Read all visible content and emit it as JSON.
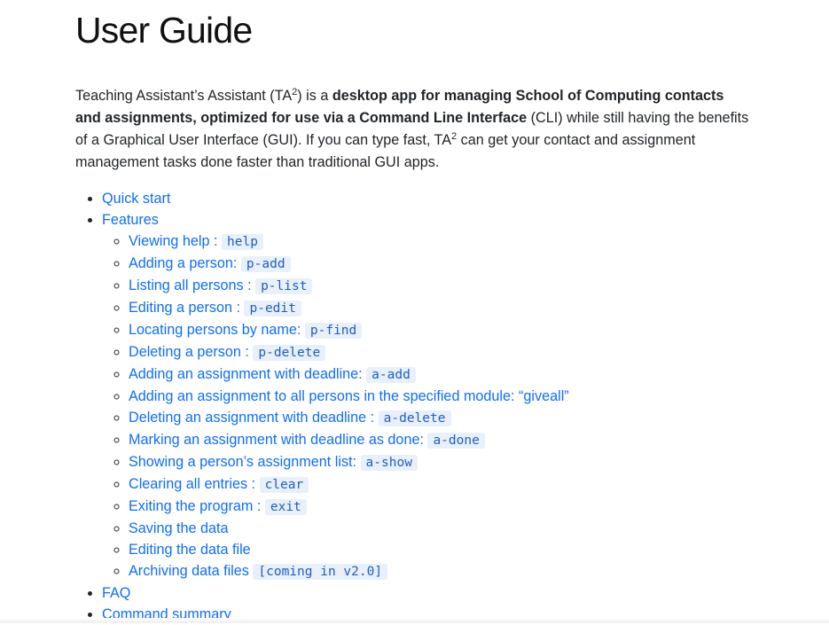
{
  "title": "User Guide",
  "intro": {
    "part1": "Teaching Assistant’s Assistant (TA",
    "sup1": "2",
    "part2": ") is a ",
    "bold": "desktop app for managing School of Computing contacts and assignments, optimized for use via a Command Line Interface",
    "part3": " (CLI) while still having the benefits of a Graphical User Interface (GUI). If you can type fast, TA",
    "sup2": "2",
    "part4": " can get your contact and assignment management tasks done faster than traditional GUI apps."
  },
  "toc": {
    "quick_start": "Quick start",
    "features": "Features",
    "faq": "FAQ",
    "command_summary": "Command summary",
    "feature_items": [
      {
        "label": "Viewing help : ",
        "code": "help"
      },
      {
        "label": "Adding a person: ",
        "code": "p-add"
      },
      {
        "label": "Listing all persons : ",
        "code": "p-list"
      },
      {
        "label": "Editing a person : ",
        "code": "p-edit"
      },
      {
        "label": "Locating persons by name: ",
        "code": "p-find"
      },
      {
        "label": "Deleting a person : ",
        "code": "p-delete"
      },
      {
        "label": "Adding an assignment with deadline: ",
        "code": "a-add"
      },
      {
        "label": "Adding an assignment to all persons in the specified module: “giveall”",
        "code": ""
      },
      {
        "label": "Deleting an assignment with deadline : ",
        "code": "a-delete"
      },
      {
        "label": "Marking an assignment with deadline as done: ",
        "code": "a-done"
      },
      {
        "label": "Showing a person’s assignment list: ",
        "code": "a-show"
      },
      {
        "label": "Clearing all entries : ",
        "code": "clear"
      },
      {
        "label": "Exiting the program : ",
        "code": "exit"
      },
      {
        "label": "Saving the data",
        "code": ""
      },
      {
        "label": "Editing the data file",
        "code": ""
      },
      {
        "label": "Archiving data files ",
        "code": "[coming in v2.0]"
      }
    ]
  },
  "colors": {
    "link": "#0d6efd",
    "code_bg": "#e8f0fb",
    "text": "#212529"
  }
}
